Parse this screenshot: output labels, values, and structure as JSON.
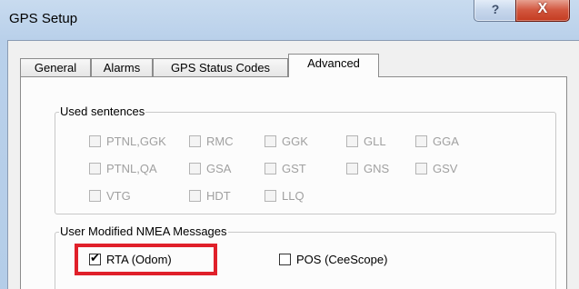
{
  "window": {
    "title": "GPS Setup",
    "help_button": "?",
    "close_button": "X"
  },
  "tabs": [
    {
      "label": "General",
      "active": false
    },
    {
      "label": "Alarms",
      "active": false
    },
    {
      "label": "GPS Status Codes",
      "active": false
    },
    {
      "label": "Advanced",
      "active": true
    }
  ],
  "used_sentences": {
    "title": "Used sentences",
    "items": [
      {
        "label": "PTNL,GGK",
        "checked": false,
        "enabled": false
      },
      {
        "label": "RMC",
        "checked": false,
        "enabled": false
      },
      {
        "label": "GGK",
        "checked": false,
        "enabled": false
      },
      {
        "label": "GLL",
        "checked": false,
        "enabled": false
      },
      {
        "label": "GGA",
        "checked": false,
        "enabled": false
      },
      {
        "label": "PTNL,QA",
        "checked": false,
        "enabled": false
      },
      {
        "label": "GSA",
        "checked": false,
        "enabled": false
      },
      {
        "label": "GST",
        "checked": false,
        "enabled": false
      },
      {
        "label": "GNS",
        "checked": false,
        "enabled": false
      },
      {
        "label": "GSV",
        "checked": false,
        "enabled": false
      },
      {
        "label": "VTG",
        "checked": false,
        "enabled": false
      },
      {
        "label": "HDT",
        "checked": false,
        "enabled": false
      },
      {
        "label": "LLQ",
        "checked": false,
        "enabled": false
      }
    ]
  },
  "user_modified_nmea": {
    "title": "User Modified NMEA Messages",
    "items": [
      {
        "label": "RTA (Odom)",
        "checked": true,
        "enabled": true
      },
      {
        "label": "POS (CeeScope)",
        "checked": false,
        "enabled": true
      }
    ]
  },
  "colors": {
    "title_bar": "#b9d0ea",
    "close_button": "#c43b20",
    "highlight": "#e0202a",
    "disabled_text": "#a0a0a0"
  }
}
